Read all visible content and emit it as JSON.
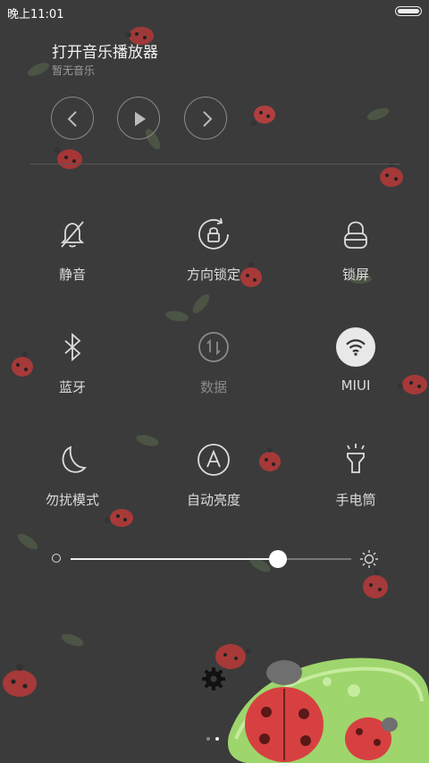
{
  "status_bar": {
    "time": "晚上11:01",
    "battery_level": 1.0
  },
  "music": {
    "title": "打开音乐播放器",
    "subtitle": "暂无音乐",
    "controls": [
      {
        "name": "previous-button",
        "icon": "chevron-left-icon"
      },
      {
        "name": "play-button",
        "icon": "play-icon"
      },
      {
        "name": "next-button",
        "icon": "chevron-right-icon"
      }
    ]
  },
  "toggles": [
    {
      "label": "静音",
      "icon": "bell-off-icon",
      "enabled": true
    },
    {
      "label": "方向锁定",
      "icon": "rotation-lock-icon",
      "enabled": true
    },
    {
      "label": "锁屏",
      "icon": "lock-icon",
      "enabled": true
    },
    {
      "label": "蓝牙",
      "icon": "bluetooth-icon",
      "enabled": true
    },
    {
      "label": "数据",
      "icon": "mobile-data-icon",
      "enabled": false
    },
    {
      "label": "MIUI",
      "icon": "wifi-icon",
      "enabled": true,
      "active": true
    },
    {
      "label": "勿扰模式",
      "icon": "moon-icon",
      "enabled": true
    },
    {
      "label": "自动亮度",
      "icon": "auto-brightness-icon",
      "enabled": true
    },
    {
      "label": "手电筒",
      "icon": "flashlight-icon",
      "enabled": true
    }
  ],
  "brightness": {
    "level": 0.74
  },
  "pager": {
    "pages": 2,
    "current": 2
  },
  "colors": {
    "background": "#3b3b3b",
    "text": "#dcdcdc",
    "accent": "#ffffff"
  }
}
